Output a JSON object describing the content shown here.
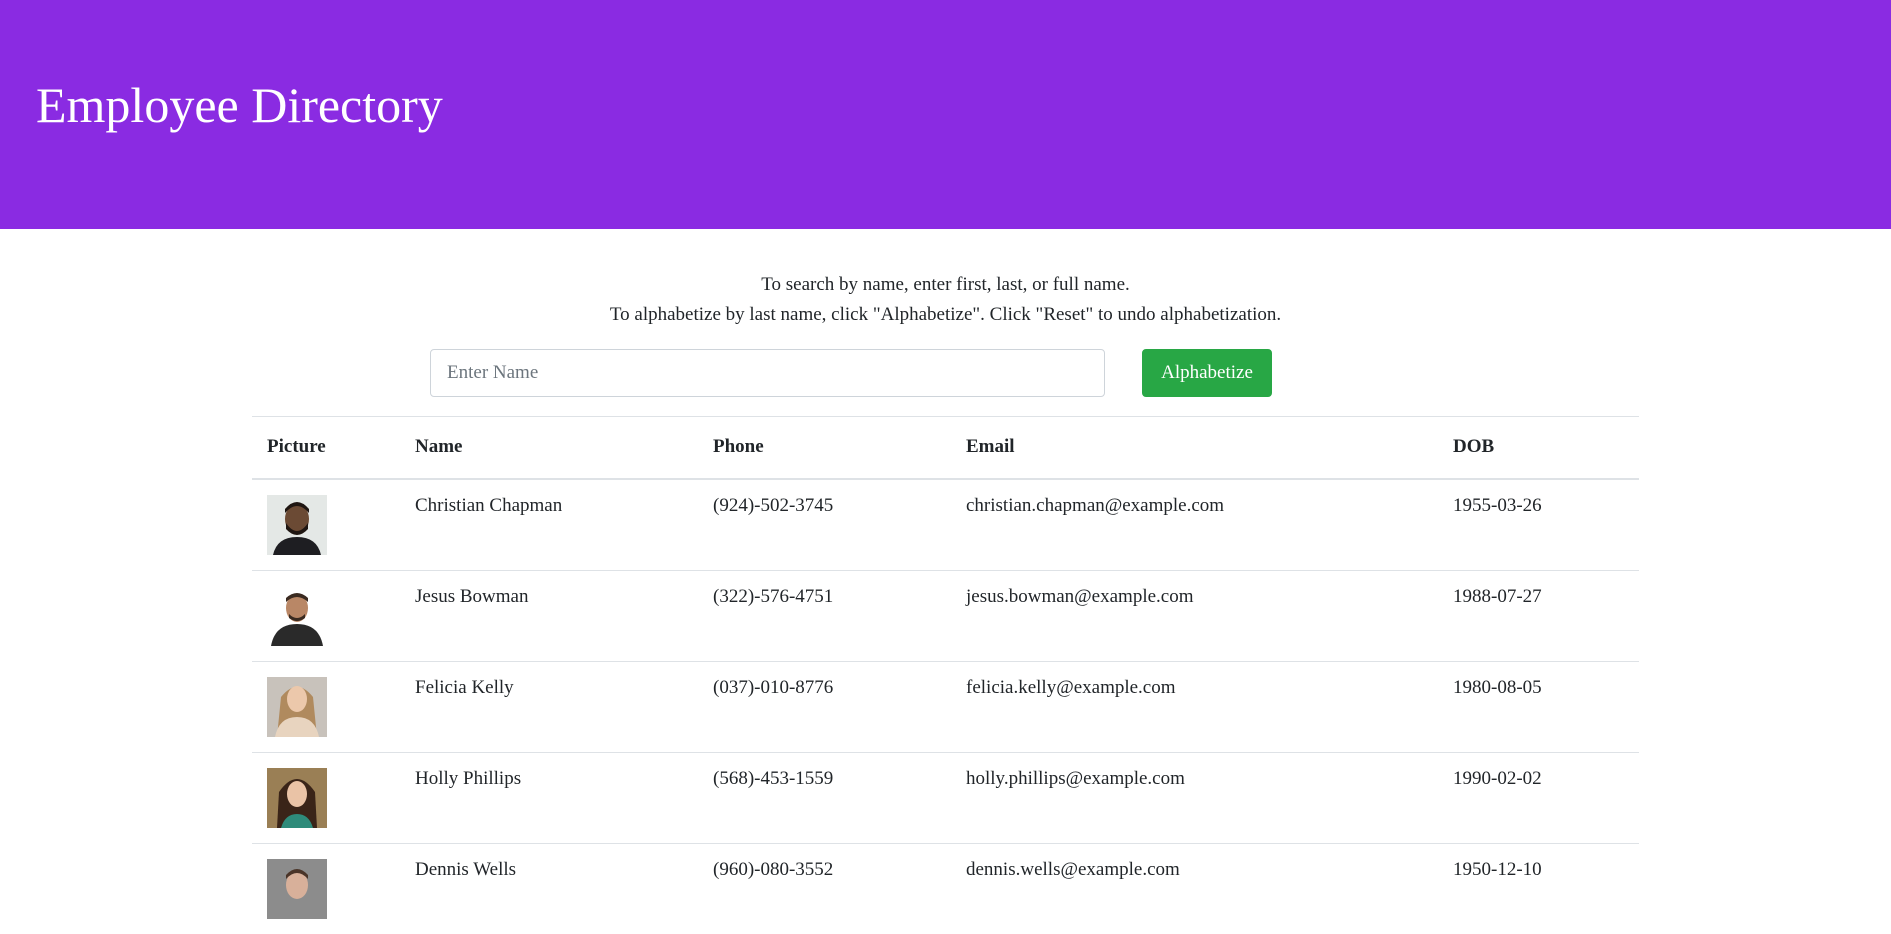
{
  "header": {
    "title": "Employee Directory",
    "bg_color": "#8a2be2"
  },
  "instructions": {
    "line1": "To search by name, enter first, last, or full name.",
    "line2": "To alphabetize by last name, click \"Alphabetize\". Click \"Reset\" to undo alphabetization."
  },
  "search": {
    "placeholder": "Enter Name",
    "value": ""
  },
  "alphabetize_button": {
    "label": "Alphabetize",
    "color": "#28a745"
  },
  "table": {
    "columns": [
      "Picture",
      "Name",
      "Phone",
      "Email",
      "DOB"
    ],
    "rows": [
      {
        "name": "Christian Chapman",
        "phone": "(924)-502-3745",
        "email": "christian.chapman@example.com",
        "dob": "1955-03-26"
      },
      {
        "name": "Jesus Bowman",
        "phone": "(322)-576-4751",
        "email": "jesus.bowman@example.com",
        "dob": "1988-07-27"
      },
      {
        "name": "Felicia Kelly",
        "phone": "(037)-010-8776",
        "email": "felicia.kelly@example.com",
        "dob": "1980-08-05"
      },
      {
        "name": "Holly Phillips",
        "phone": "(568)-453-1559",
        "email": "holly.phillips@example.com",
        "dob": "1990-02-02"
      },
      {
        "name": "Dennis Wells",
        "phone": "(960)-080-3552",
        "email": "dennis.wells@example.com",
        "dob": "1950-12-10"
      }
    ]
  }
}
